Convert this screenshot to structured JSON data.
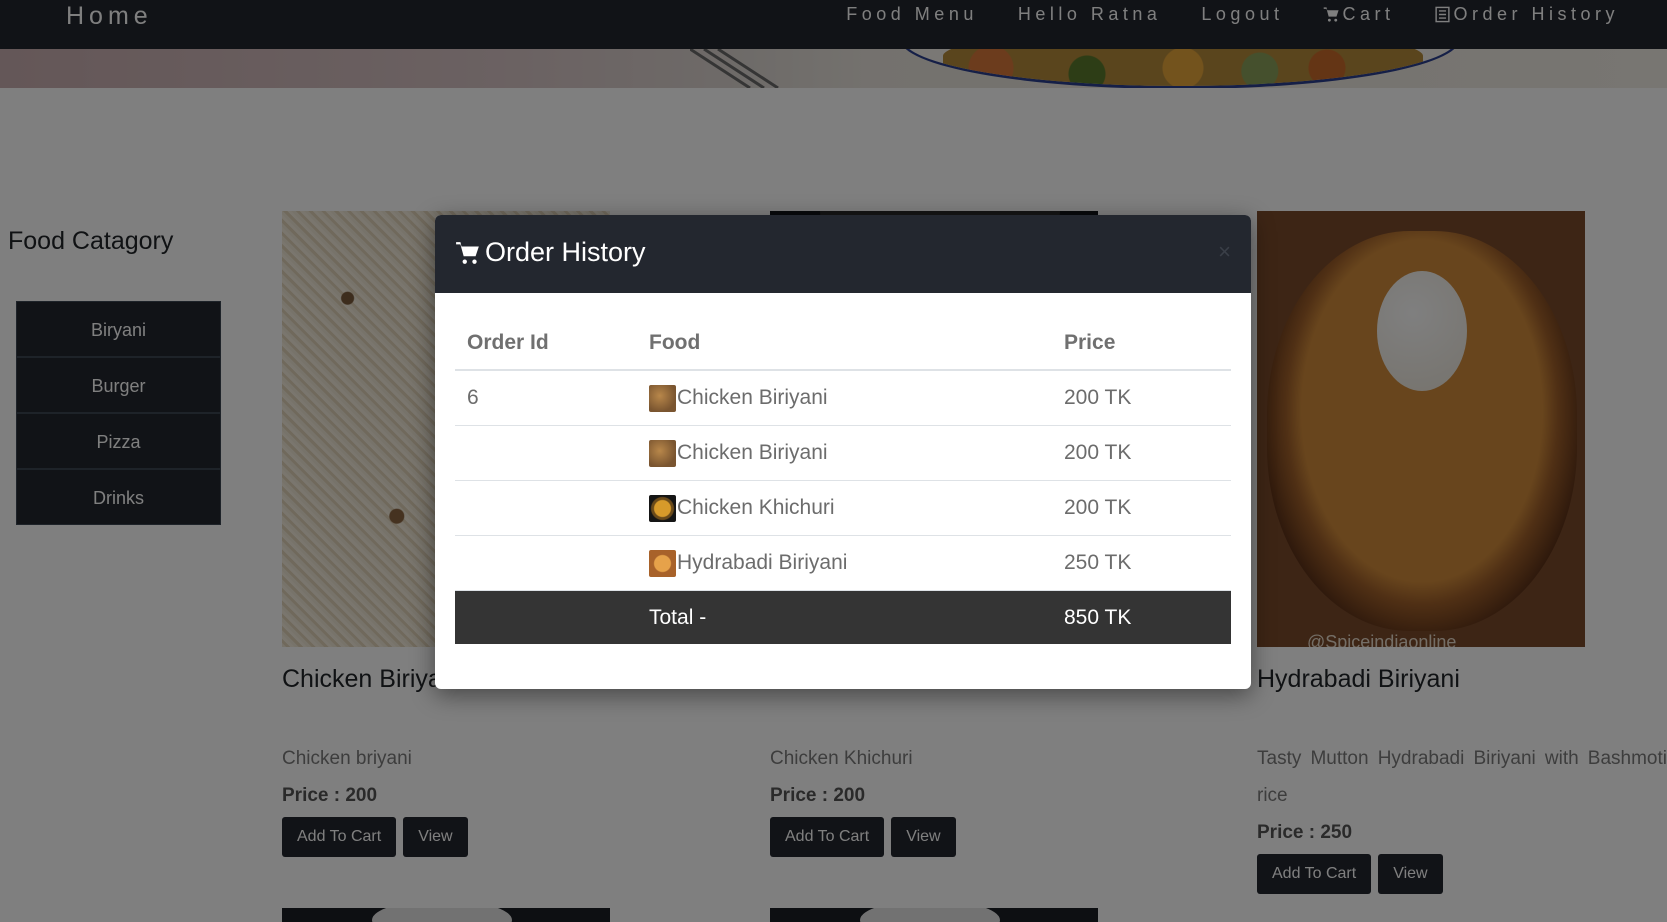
{
  "nav": {
    "home": "Home",
    "links": [
      {
        "label": "Food Menu",
        "icon": ""
      },
      {
        "label": "Hello Ratna",
        "icon": ""
      },
      {
        "label": "Logout",
        "icon": ""
      },
      {
        "label": "Cart",
        "icon": "cart-icon"
      },
      {
        "label": "Order History",
        "icon": "list-icon"
      }
    ]
  },
  "sidebar": {
    "title": "Food Catagory",
    "categories": [
      "Biryani",
      "Burger",
      "Pizza",
      "Drinks"
    ]
  },
  "cards": [
    {
      "name": "Chicken Biriyani",
      "desc": "Chicken briyani",
      "price": "Price : 200",
      "add": "Add To Cart",
      "view": "View"
    },
    {
      "name": "Chicken Khichuri",
      "desc": "Chicken Khichuri",
      "price": "Price : 200",
      "add": "Add To Cart",
      "view": "View"
    },
    {
      "name": "Hydrabadi Biriyani",
      "desc": "Tasty Mutton Hydrabadi Biriyani with Bashmoti rice",
      "price": "Price : 250",
      "add": "Add To Cart",
      "view": "View",
      "watermark": "@Spiceindiaonline"
    }
  ],
  "modal": {
    "title": "Order History",
    "close": "×",
    "headers": [
      "Order Id",
      "Food",
      "Price"
    ],
    "rows": [
      {
        "id": "6",
        "food": "Chicken Biriyani",
        "price": "200 TK"
      },
      {
        "id": "",
        "food": "Chicken Biriyani",
        "price": "200 TK"
      },
      {
        "id": "",
        "food": "Chicken Khichuri",
        "price": "200 TK"
      },
      {
        "id": "",
        "food": "Hydrabadi Biriyani",
        "price": "250 TK"
      }
    ],
    "total_label": "Total -",
    "total_value": "850 TK"
  },
  "colors": {
    "navbar": "#23272f",
    "total_row": "#343434",
    "overlay": "rgba(0,0,0,0.5)"
  }
}
